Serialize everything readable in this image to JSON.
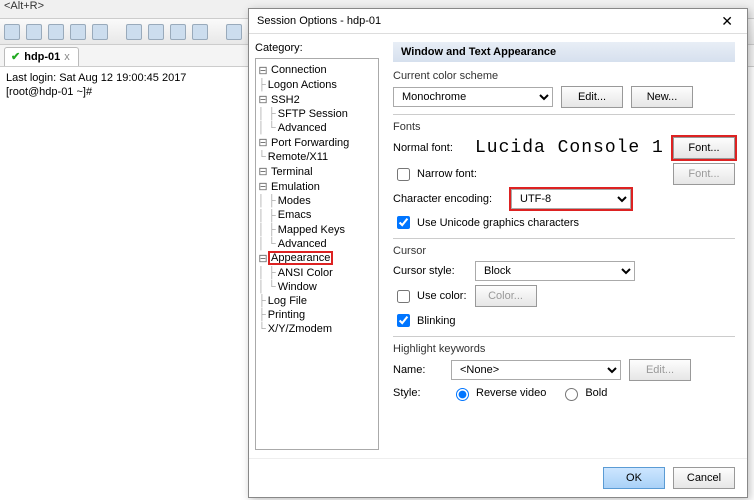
{
  "topbar": {
    "hint": "<Alt+R>"
  },
  "tab": {
    "name": "hdp-01",
    "close": "x"
  },
  "terminal": {
    "line1": "Last login: Sat Aug 12 19:00:45 2017",
    "line2": "[root@hdp-01 ~]#"
  },
  "dialog": {
    "title": "Session Options - hdp-01",
    "close": "✕",
    "category_label": "Category:"
  },
  "tree": {
    "connection": "Connection",
    "logon_actions": "Logon Actions",
    "ssh2": "SSH2",
    "sftp_session": "SFTP Session",
    "advanced_ssh": "Advanced",
    "port_fwd": "Port Forwarding",
    "remote_x11": "Remote/X11",
    "terminal": "Terminal",
    "emulation": "Emulation",
    "modes": "Modes",
    "emacs": "Emacs",
    "mapped_keys": "Mapped Keys",
    "advanced_emu": "Advanced",
    "appearance": "Appearance",
    "ansi_color": "ANSI Color",
    "window": "Window",
    "log_file": "Log File",
    "printing": "Printing",
    "xyz": "X/Y/Zmodem"
  },
  "panel": {
    "title": "Window and Text Appearance",
    "color_scheme_label": "Current color scheme",
    "color_scheme_value": "Monochrome",
    "edit_btn": "Edit...",
    "new_btn": "New...",
    "fonts_label": "Fonts",
    "normal_font_label": "Normal font:",
    "normal_font_value": "Lucida Console 1",
    "font_btn": "Font...",
    "narrow_font_label": "Narrow font:",
    "narrow_font_btn": "Font...",
    "char_enc_label": "Character encoding:",
    "char_enc_value": "UTF-8",
    "unicode_cb": "Use Unicode graphics characters",
    "cursor_label": "Cursor",
    "cursor_style_label": "Cursor style:",
    "cursor_style_value": "Block",
    "use_color_label": "Use color:",
    "color_btn": "Color...",
    "blinking_label": "Blinking",
    "highlight_label": "Highlight keywords",
    "hk_name_label": "Name:",
    "hk_name_value": "<None>",
    "hk_edit_btn": "Edit...",
    "hk_style_label": "Style:",
    "reverse_video": "Reverse video",
    "bold": "Bold"
  },
  "footer": {
    "ok": "OK",
    "cancel": "Cancel"
  }
}
